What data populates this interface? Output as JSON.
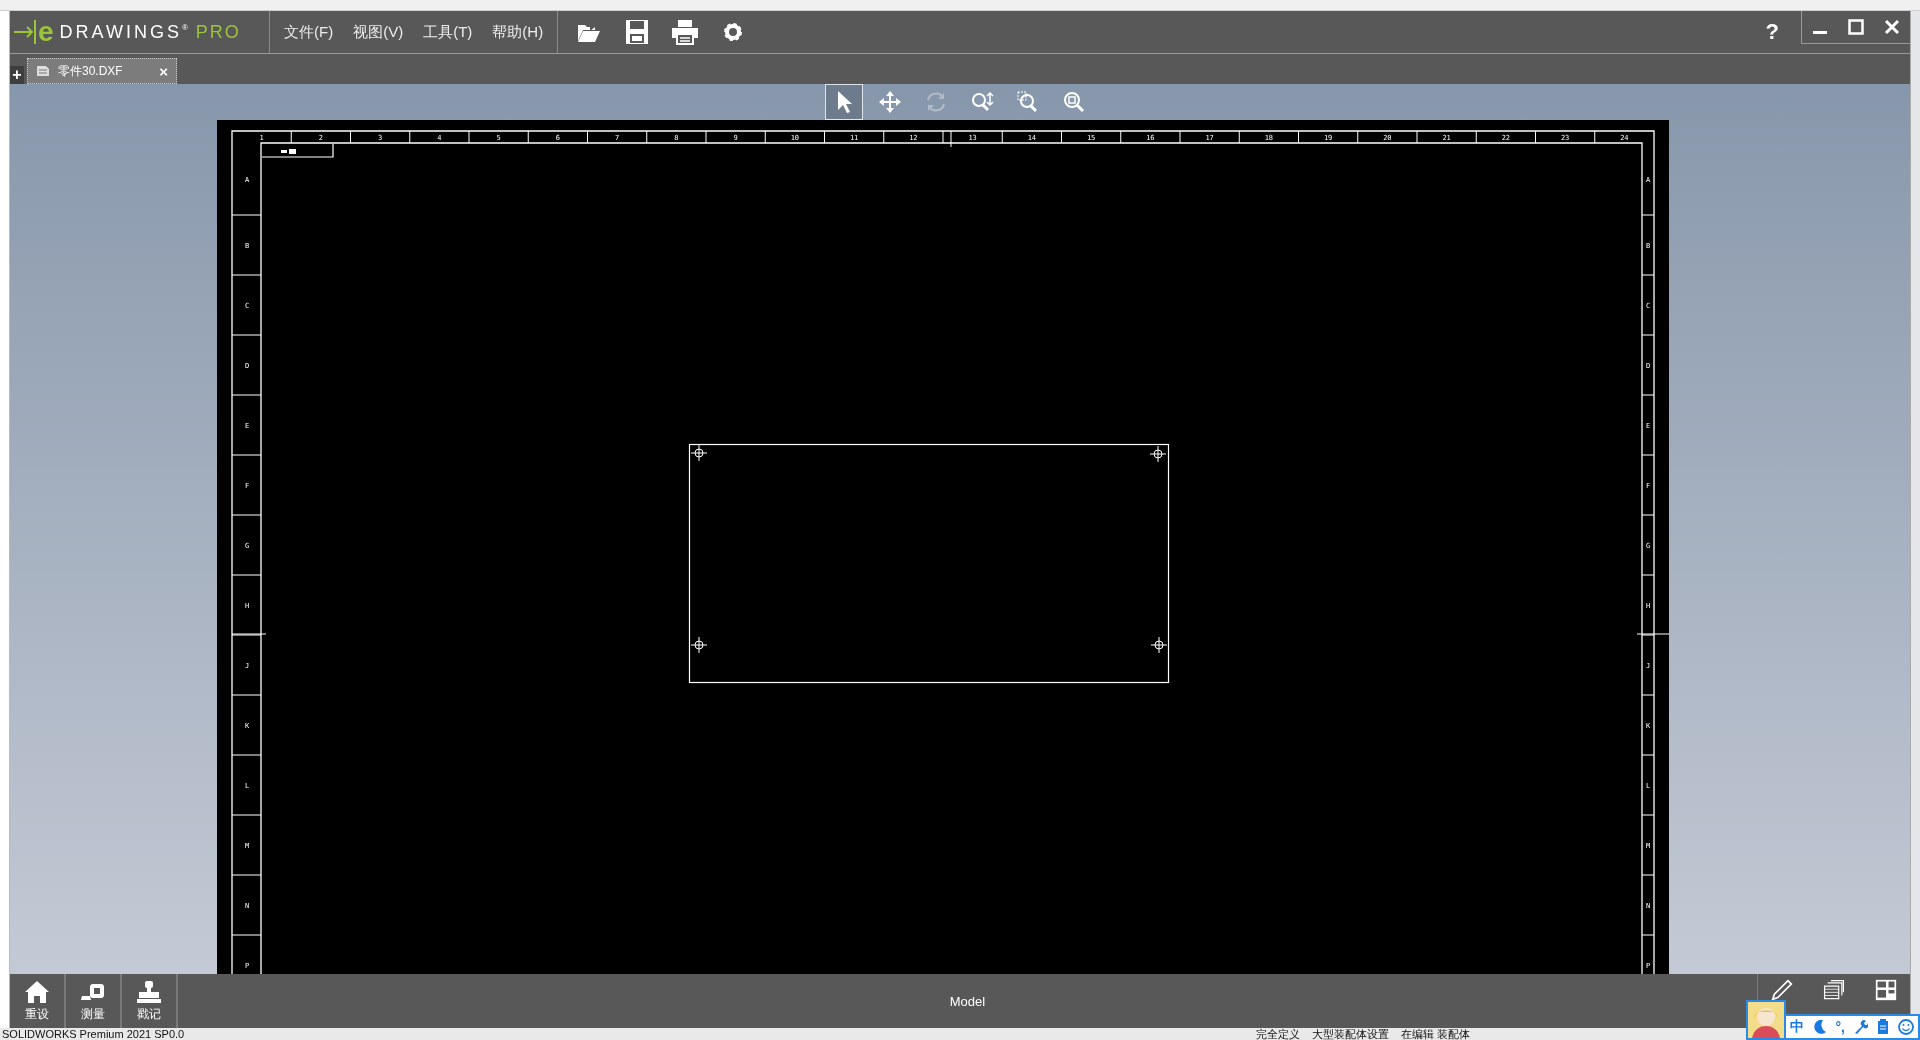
{
  "window": {
    "logo": {
      "letter": "e",
      "name": "DRAWINGS",
      "mark": "®",
      "edition": "PRO"
    },
    "menu": [
      {
        "label": "文件(F)"
      },
      {
        "label": "视图(V)"
      },
      {
        "label": "工具(T)"
      },
      {
        "label": "帮助(H)"
      }
    ],
    "toolbar": [
      {
        "kind": "open"
      },
      {
        "kind": "save"
      },
      {
        "kind": "print"
      },
      {
        "kind": "settings"
      }
    ],
    "help": "?",
    "controls": [
      {
        "kind": "minimize"
      },
      {
        "kind": "maximize"
      },
      {
        "kind": "close"
      }
    ]
  },
  "new_tab": "+",
  "tabs": [
    {
      "label": "零件30.DXF",
      "close": "×",
      "selected": true
    }
  ],
  "view_tools": [
    {
      "kind": "select",
      "selected": true,
      "disabled": false
    },
    {
      "kind": "pan",
      "selected": false,
      "disabled": false
    },
    {
      "kind": "rotate",
      "selected": false,
      "disabled": true
    },
    {
      "kind": "zoom",
      "selected": false,
      "disabled": false
    },
    {
      "kind": "zoom_area",
      "selected": false,
      "disabled": false
    },
    {
      "kind": "zoom_fit",
      "selected": false,
      "disabled": false
    }
  ],
  "drawing": {
    "column_labels": [
      "1",
      "2",
      "3",
      "4",
      "5",
      "6",
      "7",
      "8",
      "9",
      "10",
      "11",
      "12",
      "13",
      "14",
      "15",
      "16",
      "17",
      "18",
      "19",
      "20",
      "21",
      "22",
      "23",
      "24"
    ],
    "left_row_labels": [
      "A",
      "B",
      "C",
      "D",
      "E",
      "F",
      "G",
      "H",
      "J",
      "K",
      "L",
      "M",
      "N",
      "P"
    ],
    "right_row_labels": [
      "A",
      "B",
      "C",
      "D",
      "E",
      "F",
      "G",
      "H",
      "J",
      "K",
      "L",
      "M",
      "N",
      "P"
    ]
  },
  "bottom_bar": {
    "buttons": [
      {
        "kind": "reset",
        "label": "重设"
      },
      {
        "kind": "measure",
        "label": "测量"
      },
      {
        "kind": "stamp",
        "label": "戳记"
      }
    ],
    "sheet_label": "Model",
    "tools": [
      {
        "kind": "markup"
      },
      {
        "kind": "layers"
      },
      {
        "kind": "layout"
      }
    ]
  },
  "ime": {
    "mode": "中",
    "punctuation": "°,"
  },
  "status_bar": {
    "product": "SOLIDWORKS Premium 2021 SP0.0",
    "items": [
      "完全定义",
      "大型装配体设置",
      "在编辑 装配体"
    ]
  }
}
